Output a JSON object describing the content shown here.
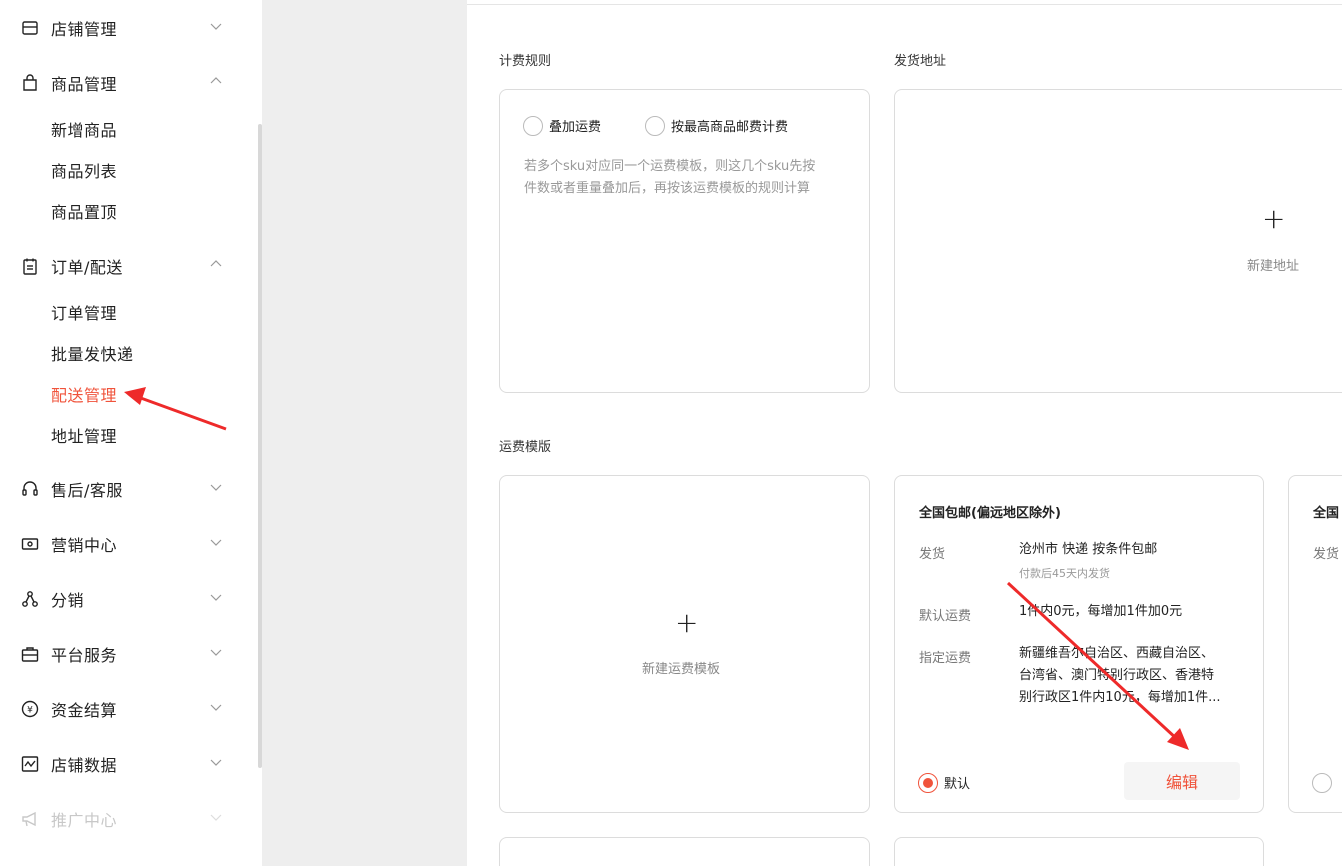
{
  "sidebar": {
    "items": [
      {
        "label": "店铺管理",
        "icon": "store-icon",
        "expanded": false
      },
      {
        "label": "商品管理",
        "icon": "shopping-bag-icon",
        "expanded": true,
        "children": [
          "新增商品",
          "商品列表",
          "商品置顶"
        ]
      },
      {
        "label": "订单/配送",
        "icon": "clipboard-icon",
        "expanded": true,
        "children": [
          "订单管理",
          "批量发快递",
          "配送管理",
          "地址管理"
        ]
      },
      {
        "label": "售后/客服",
        "icon": "headset-icon",
        "expanded": false
      },
      {
        "label": "营销中心",
        "icon": "ticket-icon",
        "expanded": false
      },
      {
        "label": "分销",
        "icon": "share-nodes-icon",
        "expanded": false
      },
      {
        "label": "平台服务",
        "icon": "briefcase-icon",
        "expanded": false
      },
      {
        "label": "资金结算",
        "icon": "yen-coin-icon",
        "expanded": false
      },
      {
        "label": "店铺数据",
        "icon": "chart-icon",
        "expanded": false
      },
      {
        "label": "推广中心",
        "icon": "megaphone-icon",
        "expanded": false,
        "disabled": true
      }
    ],
    "active_item": "配送管理",
    "accent_color": "#f0533b"
  },
  "billing_rule": {
    "title": "计费规则",
    "options": [
      "叠加运费",
      "按最高商品邮费计费"
    ],
    "hint_line1": "若多个sku对应同一个运费模板，则这几个sku先按",
    "hint_line2": "件数或者重量叠加后，再按该运费模板的规则计算"
  },
  "ship_address": {
    "title": "发货地址",
    "add_label": "新建地址",
    "plus": "+"
  },
  "shipping_templates": {
    "title": "运费模版",
    "new_label": "新建运费模板",
    "plus": "+",
    "templates": [
      {
        "name": "全国包邮(偏远地区除外)",
        "ship_key": "发货",
        "ship_value": "沧州市 快递 按条件包邮",
        "ship_sub": "付款后45天内发货",
        "default_fee_key": "默认运费",
        "default_fee_value": "1件内0元，每增加1件加0元",
        "specified_fee_key": "指定运费",
        "specified_line1": "新疆维吾尔自治区、西藏自治区、",
        "specified_line2": "台湾省、澳门特别行政区、香港特",
        "specified_line3": "别行政区1件内10元，每增加1件...",
        "default_label": "默认",
        "is_default": true,
        "edit_label": "编辑"
      },
      {
        "name": "全国",
        "ship_key": "发货"
      }
    ]
  }
}
